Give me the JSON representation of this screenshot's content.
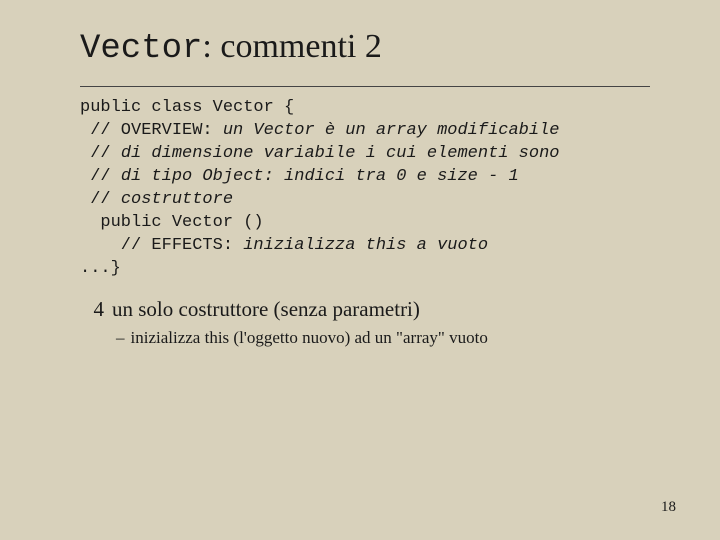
{
  "title": {
    "mono": "Vector",
    "rest": ": commenti 2"
  },
  "code": {
    "l1": "public class Vector {",
    "l2a": " // OVERVIEW: ",
    "l2b": "un Vector è un array modificabile",
    "l3a": " // ",
    "l3b": "di dimensione variabile i cui elementi sono",
    "l4a": " // ",
    "l4b": "di tipo Object: indici tra 0 e size - 1",
    "l5a": " // ",
    "l5b": "costruttore",
    "l6": "  public Vector ()",
    "l7a": "    // EFFECTS: ",
    "l7b": "inizializza this a vuoto",
    "l8": "...}"
  },
  "bullet": {
    "marker": "4",
    "text": "un solo costruttore (senza parametri)"
  },
  "subbullet": {
    "dash": "–",
    "text": "inizializza this (l'oggetto nuovo) ad un \"array\" vuoto"
  },
  "pagenum": "18"
}
